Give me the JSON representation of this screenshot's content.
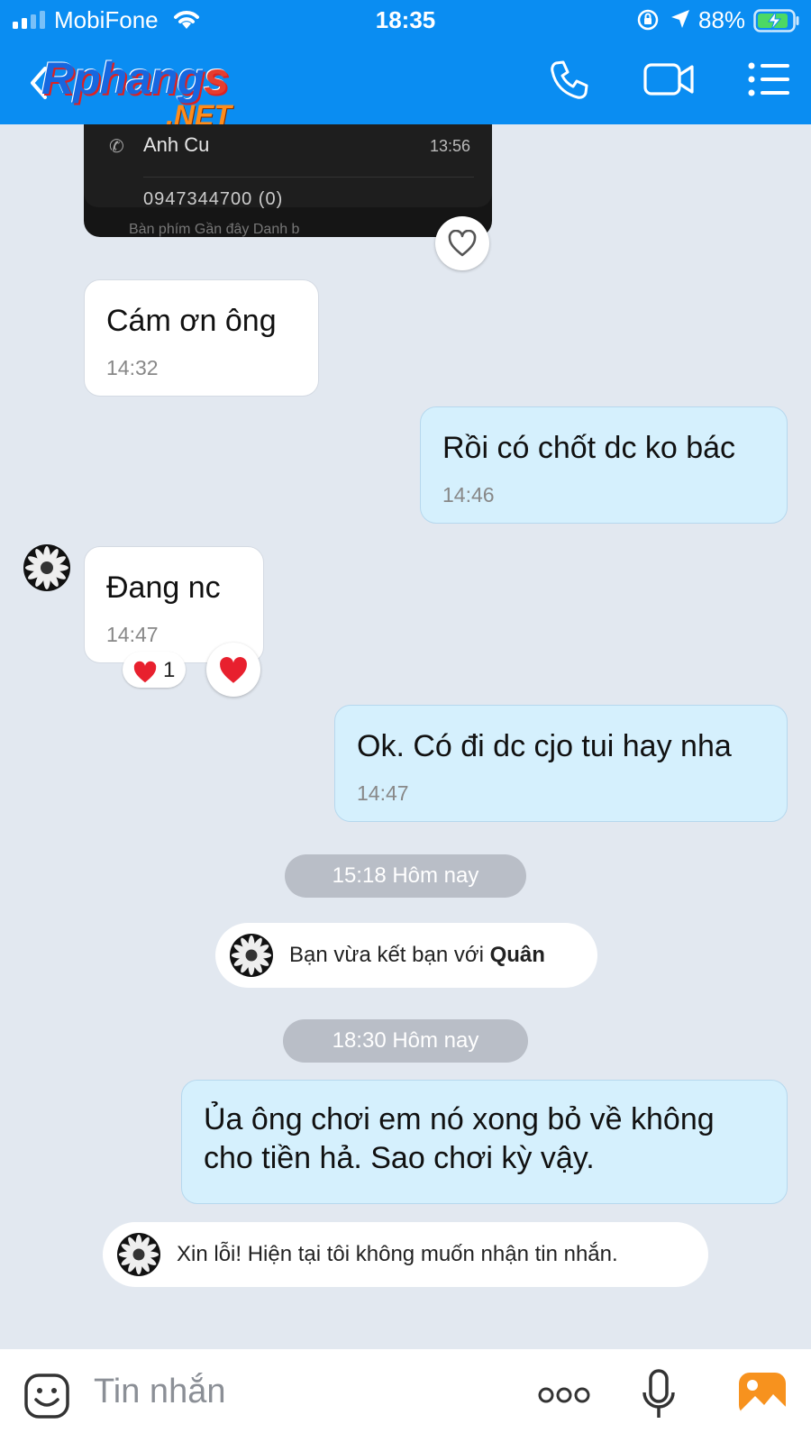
{
  "status_bar": {
    "carrier": "MobiFone",
    "time": "18:35",
    "battery": "88%"
  },
  "header": {
    "logo_main": "Rphang",
    "logo_s": "s",
    "logo_sub": ".NET"
  },
  "shared_image": {
    "contact_name": "Anh Cu",
    "time": "13:56",
    "cut_line": "0947344700 (0)",
    "tabs": "Bàn phím    Gần đây    Danh b"
  },
  "messages": [
    {
      "dir": "in",
      "text": "Cám ơn ông",
      "time": "14:32"
    },
    {
      "dir": "out",
      "text": "Rồi có chốt dc ko bác",
      "time": "14:46"
    },
    {
      "dir": "in",
      "text": "Đang nc",
      "time": "14:47",
      "reaction_count": "1"
    },
    {
      "dir": "out",
      "text": "Ok. Có đi dc cjo tui hay nha",
      "time": "14:47"
    },
    {
      "dir": "out",
      "line1": "Ủa ông chơi em nó xong bỏ về không",
      "line2": "cho tiền hả. Sao chơi kỳ vậy."
    }
  ],
  "dividers": [
    {
      "label": "15:18 Hôm nay"
    },
    {
      "label": "18:30 Hôm nay"
    }
  ],
  "system": {
    "friend_prefix": "Bạn vừa kết bạn với ",
    "friend_name": "Quân",
    "auto_reply": "Xin lỗi! Hiện tại tôi không muốn nhận tin nhắn."
  },
  "input": {
    "placeholder": "Tin nhắn"
  },
  "colors": {
    "header": "#0a8df2",
    "outgoing_bubble": "#d5f0fd",
    "incoming_bubble": "#ffffff",
    "chat_bg": "#e2e8f0",
    "reaction": "#e8202e"
  },
  "icons": [
    "back-icon",
    "phone-icon",
    "video-call-icon",
    "menu-icon",
    "heart-icon",
    "emoji-icon",
    "more-icon",
    "microphone-icon",
    "gallery-icon"
  ]
}
